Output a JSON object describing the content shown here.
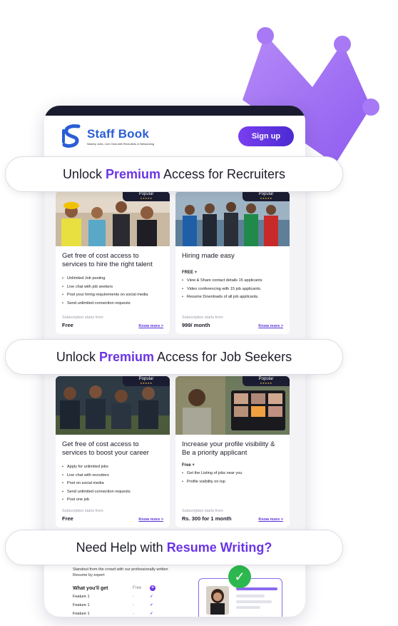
{
  "app": {
    "brand_name": "Staff Book",
    "brand_tagline": "Nearby Jobs, Live Chat with Recruiters & Networking",
    "signup_label": "Sign up"
  },
  "banners": {
    "recruiters": {
      "prefix": "Unlock ",
      "highlight": "Premium",
      "suffix": " Access for Recruiters"
    },
    "job_seekers": {
      "prefix": "Unlock ",
      "highlight": "Premium",
      "suffix": " Access for Job Seekers"
    },
    "resume": {
      "prefix": "Need Help with ",
      "highlight": "Resume Writing?"
    }
  },
  "recruiter_cards": [
    {
      "badge": "Popular",
      "stars": "★★★★★",
      "title": "Get free of cost access to services to hire the right talent",
      "free_label": "",
      "features": [
        "Unlimited Job posting",
        "Live chat with job seekers",
        "Post your hiring requirements on social media",
        "Send unlimited connection requests"
      ],
      "sub_label": "Subscription starts from",
      "price": "Free",
      "know_more": "Know more >"
    },
    {
      "badge": "Popular",
      "stars": "★★★★★",
      "title": "Hiring made easy",
      "free_label": "FREE +",
      "features": [
        "View & Share contact details 15 applicants",
        "Video conferencing with 15 job applicants.",
        "Resume Downloads of all job applicants."
      ],
      "sub_label": "Subscription starts from",
      "price": "999/ month",
      "know_more": "Know more >"
    }
  ],
  "seeker_cards": [
    {
      "badge": "Popular",
      "stars": "★★★★★",
      "title": "Get free of cost access to services to boost your career",
      "free_label": "",
      "features": [
        "Apply for unlimited jobs",
        "Live chat with recruiters",
        "Post on social media",
        "Send unlimited connection requests",
        "Post one job"
      ],
      "sub_label": "Subscription starts from",
      "price": "Free",
      "know_more": "Know more >"
    },
    {
      "badge": "Popular",
      "stars": "★★★★★",
      "title": "Increase your profile visibility & Be a priority applicant",
      "free_label": "Free +",
      "features": [
        "Get the Listing of jobs near you",
        "Profile visibility on top"
      ],
      "sub_label": "Subscription starts from",
      "price": "Rs. 300 for 1 month",
      "know_more": "Know more >"
    }
  ],
  "resume_section": {
    "intro": "Standout from the crowd with our professionally written Resume by expert",
    "table_header": {
      "feature": "What you'll get",
      "free": "Free"
    },
    "rows": [
      {
        "feature": "Feature 1",
        "free": "-",
        "premium": "✓"
      },
      {
        "feature": "Feature 1",
        "free": "-",
        "premium": "✓"
      },
      {
        "feature": "Feature 1",
        "free": "-",
        "premium": "✓"
      }
    ]
  },
  "colors": {
    "accent": "#6b35e6",
    "brand_blue": "#2a5dd6",
    "dark": "#1b1d33",
    "crown": "#a97cf5",
    "check_green": "#2db84f"
  }
}
